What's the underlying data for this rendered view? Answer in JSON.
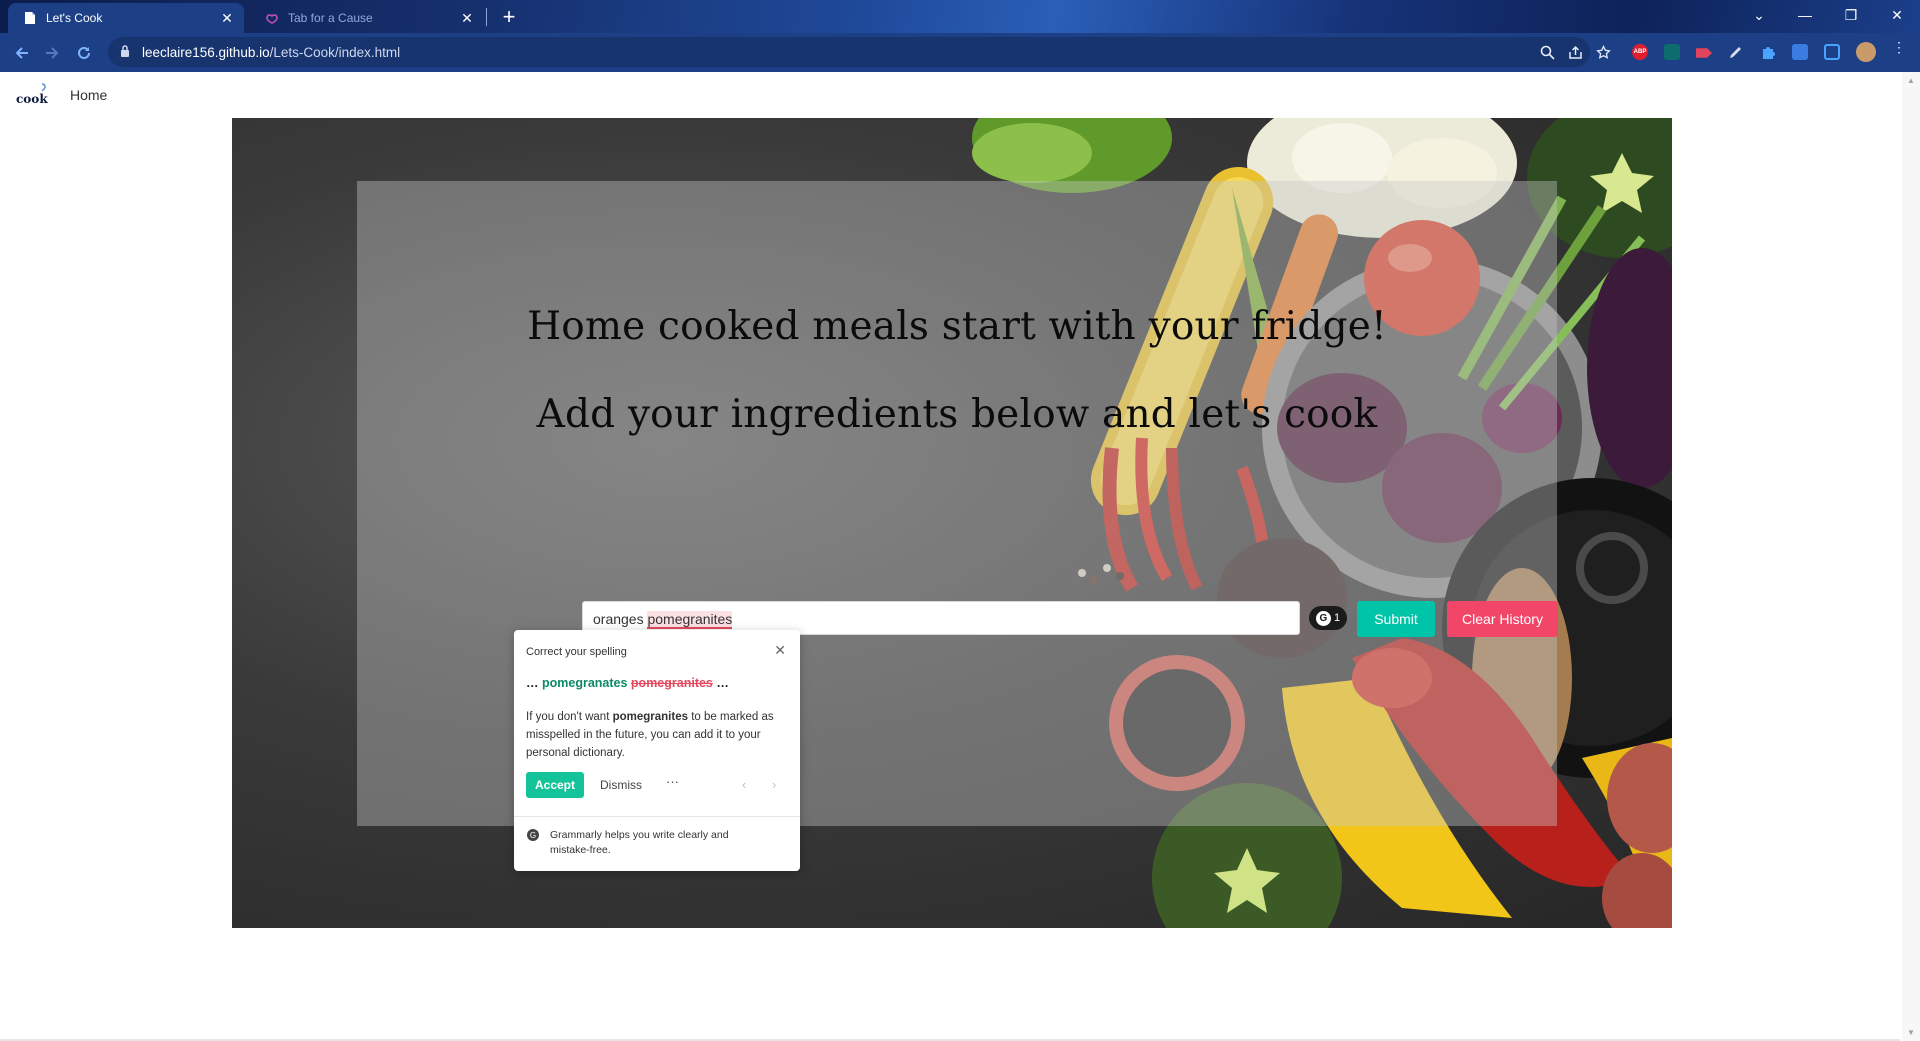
{
  "browser": {
    "tabs": [
      {
        "title": "Let's Cook",
        "active": true
      },
      {
        "title": "Tab for a Cause",
        "active": false
      }
    ],
    "new_tab_symbol": "+",
    "close_symbol": "✕",
    "url_domain": "leeclaire156.github.io",
    "url_path": "/Lets-Cook/index.html",
    "window_controls": {
      "dropdown": "⌄",
      "minimize": "—",
      "restore": "❐",
      "close": "✕"
    },
    "extension_badge": "ABP",
    "colors": {
      "frame": "#1d3f86",
      "omnibox": "#17346f"
    }
  },
  "page": {
    "logo_text": "cook",
    "nav": {
      "home": "Home"
    },
    "hero": {
      "heading_1": "Home cooked meals start with your fridge!",
      "heading_2": "Add your ingredients below and let's cook"
    },
    "search": {
      "value_plain": "oranges",
      "value_misspelled": "pomegranites"
    },
    "grammarly_badge_count": "1",
    "grammarly_badge_letter": "G",
    "buttons": {
      "submit": "Submit",
      "clear": "Clear History"
    },
    "colors": {
      "submit": "#00c4a7",
      "clear": "#f14668",
      "overlay": "rgba(200,200,200,0.40)"
    }
  },
  "grammarly_popup": {
    "header": "Correct your spelling",
    "close": "✕",
    "suggestion_prefix": "…",
    "suggestion_correct": "pomegranates",
    "suggestion_wrong": "pomegranites",
    "suggestion_suffix": "…",
    "body_1": "If you don't want ",
    "body_word": "pomegranites",
    "body_2": " to be marked as misspelled in the future, you can add it to your personal dictionary.",
    "accept": "Accept",
    "dismiss": "Dismiss",
    "more": "···",
    "prev": "‹",
    "next": "›",
    "footer": "Grammarly helps you write clearly and mistake-free.",
    "footer_icon": "G"
  }
}
